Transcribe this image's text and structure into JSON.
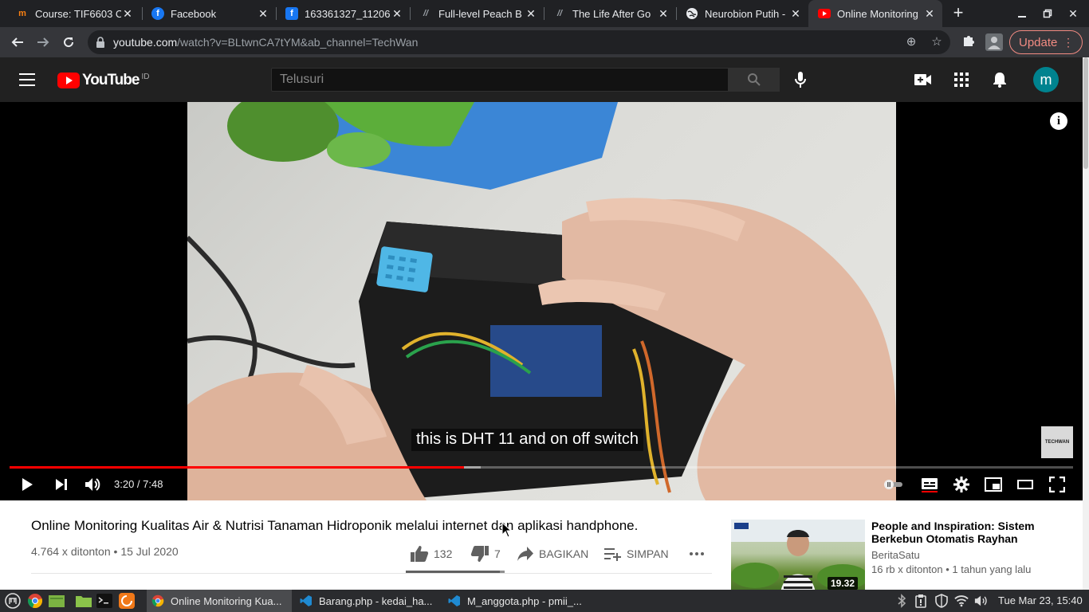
{
  "browser": {
    "tabs": [
      {
        "title": "Course: TIF6603 C",
        "favicon": "moodle-icon",
        "color": "#f98012"
      },
      {
        "title": "Facebook",
        "favicon": "facebook-icon",
        "color": "#1877f2"
      },
      {
        "title": "163361327_11206",
        "favicon": "facebook-icon",
        "color": "#1877f2"
      },
      {
        "title": "Full-level Peach B",
        "favicon": "web-icon",
        "color": "#9aa0a6"
      },
      {
        "title": "The Life After Go",
        "favicon": "web-icon",
        "color": "#9aa0a6"
      },
      {
        "title": "Neurobion Putih -",
        "favicon": "globe-icon",
        "color": "#e8eaed"
      },
      {
        "title": "Online Monitoring",
        "favicon": "youtube-icon",
        "color": "#ff0000",
        "active": true
      }
    ],
    "url_host": "youtube.com",
    "url_rest": "/watch?v=BLtwnCA7tYM&ab_channel=TechWan",
    "update_label": "Update"
  },
  "youtube": {
    "region": "ID",
    "search_placeholder": "Telusuri",
    "avatar_letter": "m",
    "avatar_color": "#00838f"
  },
  "player": {
    "subtitle": "this is DHT 11 and on off switch",
    "time_current": "3:20",
    "time_total": "7:48",
    "time_display": "3:20 / 7:48",
    "progress_fraction": 0.427,
    "buffered_fraction": 0.443,
    "watermark": "TECHWAN"
  },
  "video": {
    "title": "Online Monitoring Kualitas Air & Nutrisi Tanaman Hidroponik melalui internet dan aplikasi handphone.",
    "views": "4.764 x ditonton",
    "date": "15 Jul 2020",
    "meta": "4.764 x ditonton • 15 Jul 2020",
    "likes": "132",
    "dislikes": "7",
    "share_label": "BAGIKAN",
    "save_label": "SIMPAN",
    "like_fraction": 0.95
  },
  "suggestion": {
    "title": "People and Inspiration: Sistem Berkebun Otomatis Rayhan",
    "channel": "BeritaSatu",
    "meta": "16 rb x ditonton • 1 tahun yang lalu",
    "duration": "19.32"
  },
  "taskbar": {
    "windows": [
      {
        "title": "Online Monitoring Kua...",
        "icon": "chrome-icon",
        "active": true
      },
      {
        "title": "Barang.php - kedai_ha...",
        "icon": "vscode-icon"
      },
      {
        "title": "M_anggota.php - pmii_...",
        "icon": "vscode-icon"
      }
    ],
    "clock": "Tue Mar 23, 15:40"
  }
}
